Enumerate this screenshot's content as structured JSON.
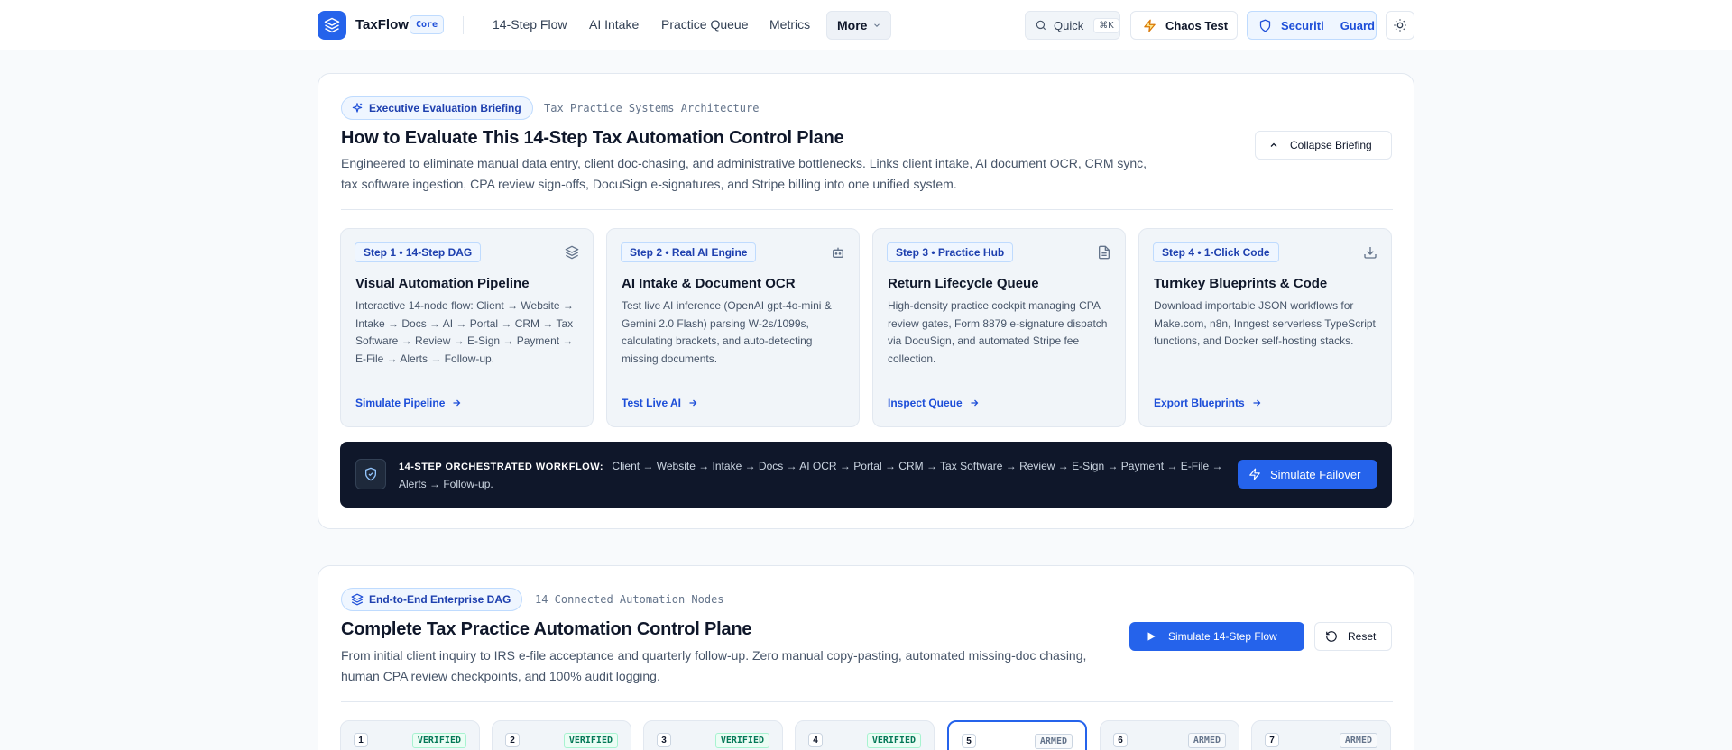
{
  "nav": {
    "brand": "TaxFlow",
    "badge": "Core",
    "links": [
      "14-Step Flow",
      "AI Intake",
      "Practice Queue",
      "Metrics"
    ],
    "more": "More",
    "quick": "Quick",
    "quick_kbd": "⌘K",
    "chaos": "Chaos Test",
    "guard_a": "Securiti",
    "guard_b": "Guard"
  },
  "briefing": {
    "pill": "Executive Evaluation Briefing",
    "kicker": "Tax Practice Systems Architecture",
    "title": "How to Evaluate This 14-Step Tax Automation Control Plane",
    "desc": "Engineered to eliminate manual data entry, client doc-chasing, and administrative bottlenecks. Links client intake, AI document OCR, CRM sync, tax software ingestion, CPA review sign-offs, DocuSign e-signatures, and Stripe billing into one unified system.",
    "collapse": "Collapse Briefing",
    "steps": [
      {
        "badge": "Step 1 • 14-Step DAG",
        "icon": "layers-icon",
        "title": "Visual Automation Pipeline",
        "text": "Interactive 14-node flow: Client → Website → Intake → Docs → AI → Portal → CRM → Tax Software → Review → E-Sign → Payment → E-File → Alerts → Follow-up.",
        "link": "Simulate Pipeline"
      },
      {
        "badge": "Step 2 • Real AI Engine",
        "icon": "bot-icon",
        "title": "AI Intake & Document OCR",
        "text": "Test live AI inference (OpenAI gpt-4o-mini & Gemini 2.0 Flash) parsing W-2s/1099s, calculating brackets, and auto-detecting missing documents.",
        "link": "Test Live AI"
      },
      {
        "badge": "Step 3 • Practice Hub",
        "icon": "document-icon",
        "title": "Return Lifecycle Queue",
        "text": "High-density practice cockpit managing CPA review gates, Form 8879 e-signature dispatch via DocuSign, and automated Stripe fee collection.",
        "link": "Inspect Queue"
      },
      {
        "badge": "Step 4 • 1-Click Code",
        "icon": "download-icon",
        "title": "Turnkey Blueprints & Code",
        "text": "Download importable JSON workflows for Make.com, n8n, Inngest serverless TypeScript functions, and Docker self-hosting stacks.",
        "link": "Export Blueprints"
      }
    ],
    "workflow_label": "14-STEP ORCHESTRATED WORKFLOW:",
    "workflow_text": "Client → Website → Intake → Docs → AI OCR → Portal → CRM → Tax Software → Review → E-Sign → Payment → E-File → Alerts → Follow-up.",
    "failover": "Simulate Failover"
  },
  "dag": {
    "pill": "End-to-End Enterprise DAG",
    "kicker": "14 Connected Automation Nodes",
    "title": "Complete Tax Practice Automation Control Plane",
    "desc": "From initial client inquiry to IRS e-file acceptance and quarterly follow-up. Zero manual copy-pasting, automated missing-doc chasing, human CPA review checkpoints, and 100% audit logging.",
    "simulate": "Simulate 14-Step Flow",
    "reset": "Reset",
    "nodes": [
      {
        "num": "1",
        "status": "VERIFIED"
      },
      {
        "num": "2",
        "status": "VERIFIED"
      },
      {
        "num": "3",
        "status": "VERIFIED"
      },
      {
        "num": "4",
        "status": "VERIFIED"
      },
      {
        "num": "5",
        "status": "ARMED"
      },
      {
        "num": "6",
        "status": "ARMED"
      },
      {
        "num": "7",
        "status": "ARMED"
      }
    ]
  },
  "colors": {
    "accent": "#2563eb",
    "dark": "#0f172a",
    "verified": "#047857"
  }
}
